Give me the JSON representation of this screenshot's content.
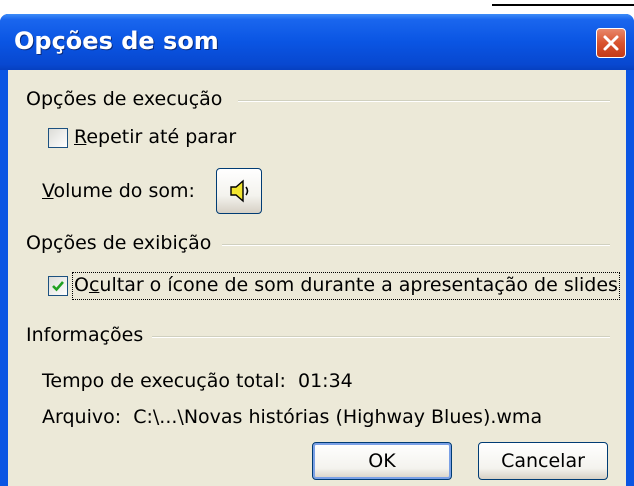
{
  "dialog": {
    "title": "Opções de som",
    "close_icon": "close-icon"
  },
  "execution": {
    "group_label": "Opções de execução",
    "loop_checkbox": {
      "label_first": "R",
      "label_rest": "epetir até parar",
      "checked": false
    },
    "volume": {
      "label_first": "V",
      "label_rest": "olume do som:",
      "icon": "speaker-icon"
    }
  },
  "display": {
    "group_label": "Opções de exibição",
    "hide_icon_checkbox": {
      "label_pre": "O",
      "label_u": "c",
      "label_rest": "ultar o ícone de som durante a apresentação de slides",
      "checked": true
    }
  },
  "info": {
    "group_label": "Informações",
    "total_time_label": "Tempo de execução total:",
    "total_time_value": "01:34",
    "file_label": "Arquivo:",
    "file_value": "C:\\...\\Novas histórias (Highway Blues).wma"
  },
  "buttons": {
    "ok": "OK",
    "cancel": "Cancelar"
  },
  "colors": {
    "titlebar": "#0a55e3",
    "client": "#ece9d8",
    "check_mark": "#21a121",
    "close_button": "#d9542f"
  }
}
